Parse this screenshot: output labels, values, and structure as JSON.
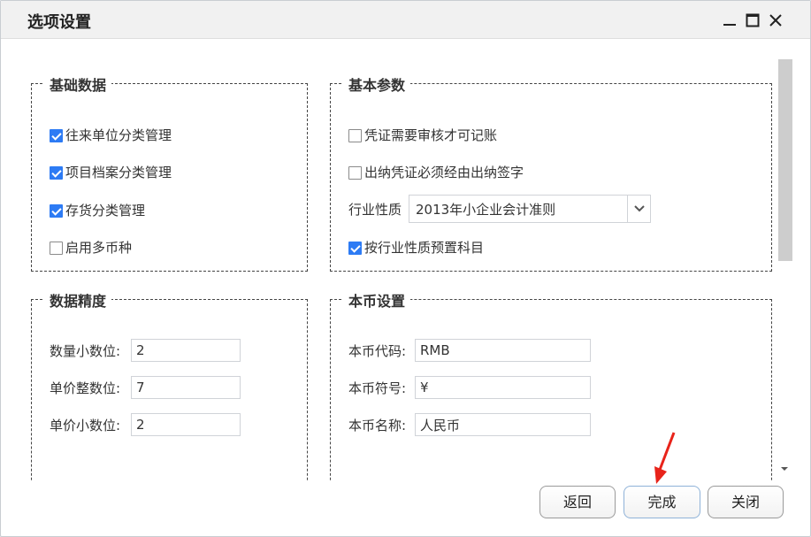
{
  "dialog": {
    "title": "选项设置",
    "window_controls": [
      "minimize-icon",
      "maximize-icon",
      "close-icon"
    ]
  },
  "basic_data": {
    "legend": "基础数据",
    "items": [
      {
        "label": "往来单位分类管理",
        "checked": true
      },
      {
        "label": "项目档案分类管理",
        "checked": true
      },
      {
        "label": "存货分类管理",
        "checked": true
      },
      {
        "label": "启用多币种",
        "checked": false
      }
    ]
  },
  "basic_params": {
    "legend": "基本参数",
    "items": [
      {
        "label": "凭证需要审核才可记账",
        "checked": false
      },
      {
        "label": "出纳凭证必须经由出纳签字",
        "checked": false
      }
    ],
    "industry_label": "行业性质",
    "industry_value": "2013年小企业会计准则",
    "preset_label": "按行业性质预置科目",
    "preset_checked": true
  },
  "precision": {
    "legend": "数据精度",
    "fields": [
      {
        "label": "数量小数位:",
        "value": "2"
      },
      {
        "label": "单价整数位:",
        "value": "7"
      },
      {
        "label": "单价小数位:",
        "value": "2"
      }
    ]
  },
  "currency": {
    "legend": "本币设置",
    "fields": [
      {
        "label": "本币代码:",
        "value": "RMB"
      },
      {
        "label": "本币符号:",
        "value": "¥"
      },
      {
        "label": "本币名称:",
        "value": "人民币"
      }
    ]
  },
  "footer": {
    "back_label": "返回",
    "finish_label": "完成",
    "close_label": "关闭"
  },
  "colors": {
    "accent": "#2d7bf4",
    "annotation_arrow": "#e8231a"
  }
}
